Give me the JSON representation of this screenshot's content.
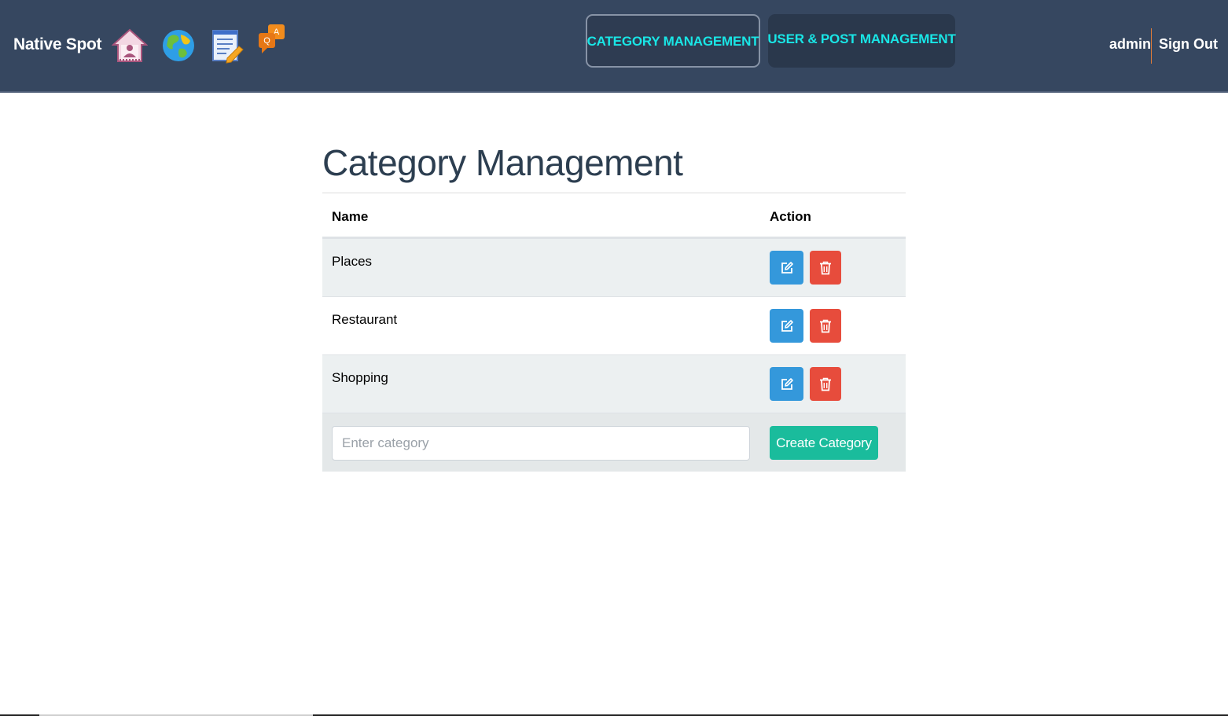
{
  "nav": {
    "brand": "Native Spot",
    "icons": [
      "home-icon",
      "globe-icon",
      "notes-icon",
      "qa-chat-icon"
    ],
    "tabs": [
      {
        "label": "CATEGORY MANAGEMENT",
        "active": true
      },
      {
        "label": "USER & POST MANAGEMENT",
        "active": false
      }
    ],
    "user": "admin",
    "sign_out": "Sign Out",
    "colors": {
      "bar": "#364760",
      "tab_text": "#19e6e6",
      "separator": "#e07b39"
    }
  },
  "main": {
    "title": "Category Management",
    "table": {
      "columns": [
        "Name",
        "Action"
      ],
      "rows": [
        {
          "name": "Places"
        },
        {
          "name": "Restaurant"
        },
        {
          "name": "Shopping"
        }
      ]
    },
    "create": {
      "placeholder": "Enter category",
      "value": "",
      "button_label": "Create Category"
    },
    "colors": {
      "edit": "#3498db",
      "delete": "#e74c3c",
      "create": "#1abc9c",
      "title": "#2c3e50"
    }
  }
}
